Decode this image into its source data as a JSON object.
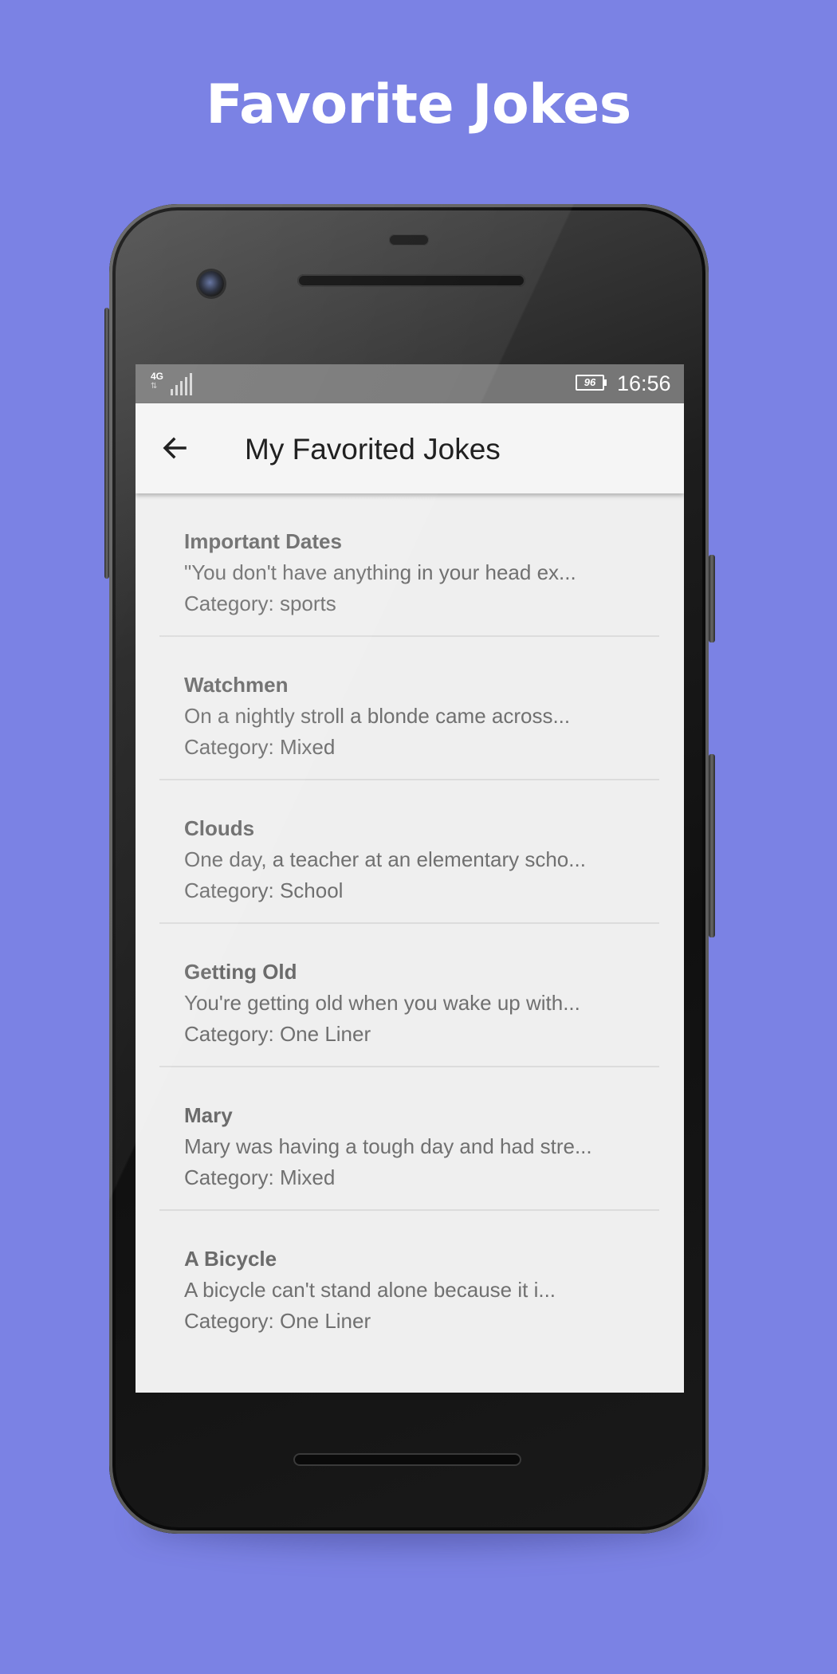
{
  "promo": {
    "title": "Favorite Jokes"
  },
  "status_bar": {
    "network": "4G",
    "network_arrows": "⇅",
    "battery": "96",
    "time": "16:56"
  },
  "app_bar": {
    "title": "My Favorited Jokes",
    "back_icon": "arrow-back-icon"
  },
  "jokes": [
    {
      "title": "Important Dates",
      "preview": "\"You don't have anything in your head ex...",
      "category": "Category: sports"
    },
    {
      "title": "Watchmen",
      "preview": "On a nightly stroll a blonde came across...",
      "category": "Category: Mixed"
    },
    {
      "title": "Clouds",
      "preview": "One day, a teacher at an elementary scho...",
      "category": "Category: School"
    },
    {
      "title": "Getting Old",
      "preview": "You're getting old when you wake up with...",
      "category": "Category: One Liner"
    },
    {
      "title": "Mary",
      "preview": "Mary was having a tough day and had stre...",
      "category": "Category: Mixed"
    },
    {
      "title": "A Bicycle",
      "preview": "A bicycle can't stand alone because it i...",
      "category": "Category: One Liner"
    }
  ],
  "colors": {
    "background": "#7b82e4",
    "status_bar": "#767676",
    "app_bar": "#f5f5f5",
    "list_background": "#efefef"
  }
}
